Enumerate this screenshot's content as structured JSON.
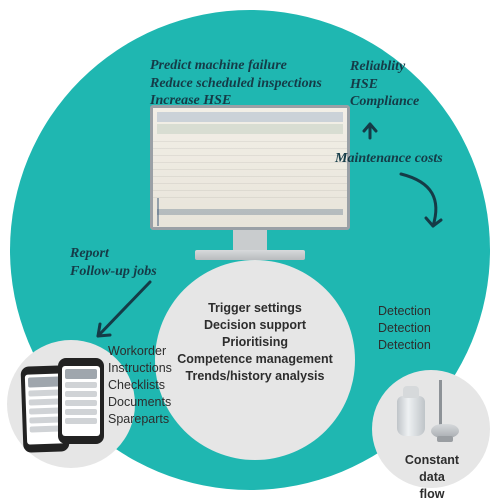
{
  "monitor_top": {
    "l1": "Predict machine failure",
    "l2": "Reduce scheduled inspections",
    "l3": "Increase HSE"
  },
  "right_top": {
    "l1": "Reliablity",
    "l2": "HSE",
    "l3": "Compliance"
  },
  "right_mid": "Maintenance costs",
  "left_mid": {
    "l1": "Report",
    "l2": "Follow-up jobs"
  },
  "left_list": {
    "l1": "Workorder",
    "l2": "Instructions",
    "l3": "Checklists",
    "l4": "Documents",
    "l5": "Spareparts"
  },
  "center_list": {
    "l1": "Trigger settings",
    "l2": "Decision support",
    "l3": "Prioritising",
    "l4": "Competence management",
    "l5": "Trends/history analysis"
  },
  "detect": {
    "l1": "Detection",
    "l2": "Detection",
    "l3": "Detection"
  },
  "constant": {
    "l1": "Constant data",
    "l2": "flow"
  }
}
